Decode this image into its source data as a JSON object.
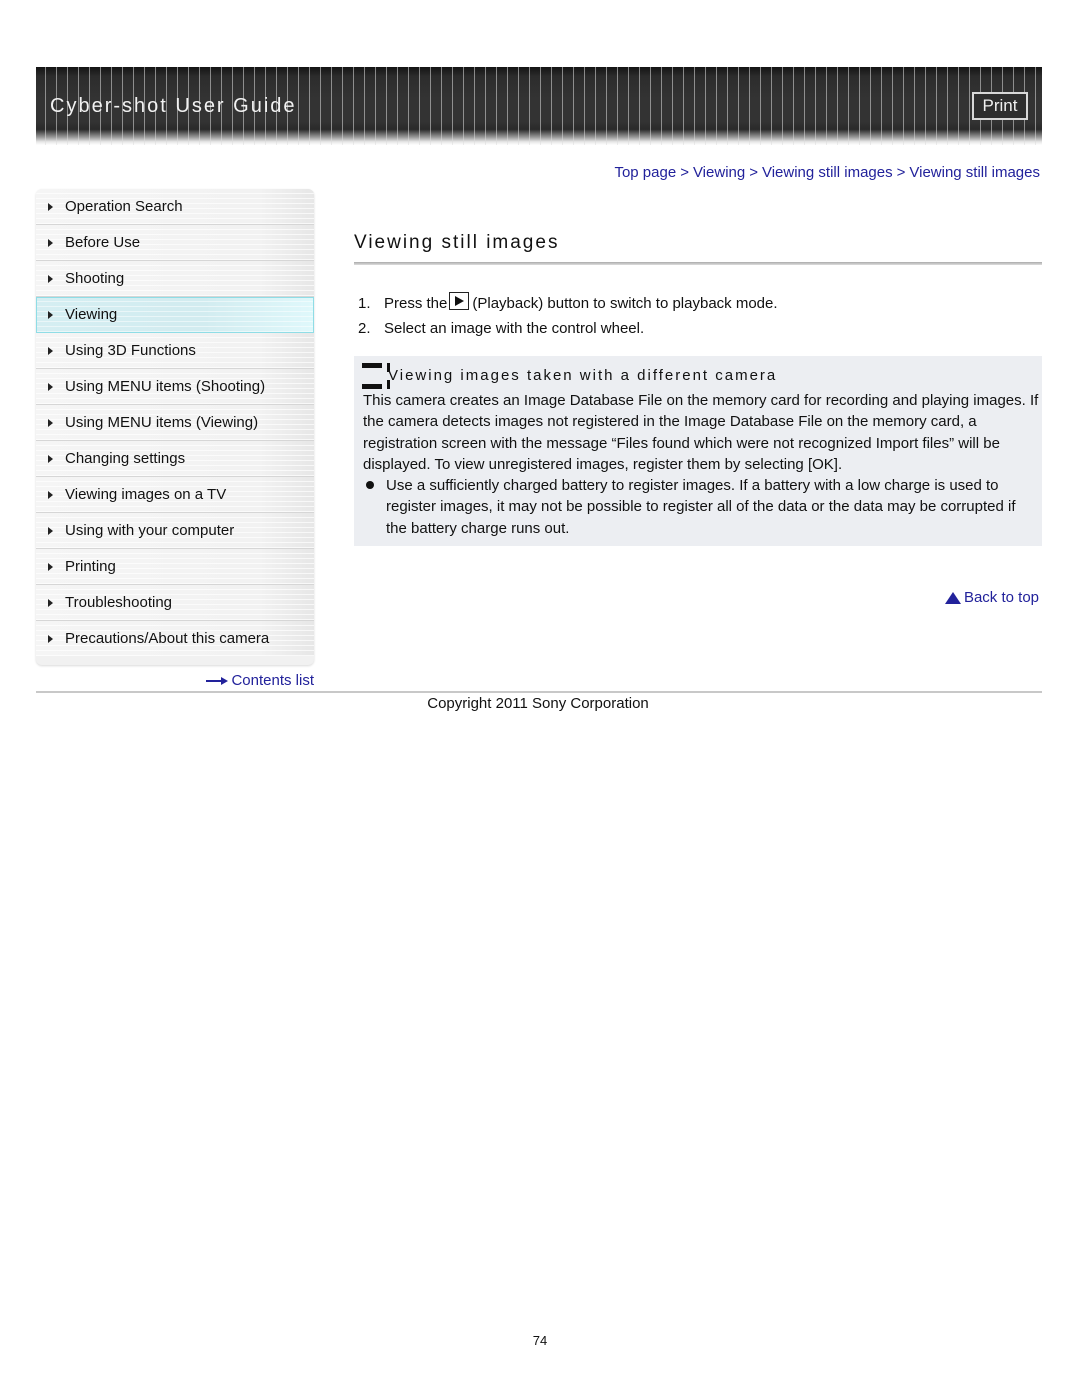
{
  "header": {
    "title": "Cyber-shot User Guide",
    "print_label": "Print"
  },
  "breadcrumb": {
    "items": [
      "Top page",
      "Viewing",
      "Viewing still images",
      "Viewing still images"
    ],
    "separator": ">"
  },
  "sidebar": {
    "items": [
      {
        "label": "Operation Search",
        "active": false
      },
      {
        "label": "Before Use",
        "active": false
      },
      {
        "label": "Shooting",
        "active": false
      },
      {
        "label": "Viewing",
        "active": true
      },
      {
        "label": "Using 3D Functions",
        "active": false
      },
      {
        "label": "Using MENU items (Shooting)",
        "active": false
      },
      {
        "label": "Using MENU items (Viewing)",
        "active": false
      },
      {
        "label": "Changing settings",
        "active": false
      },
      {
        "label": "Viewing images on a TV",
        "active": false
      },
      {
        "label": "Using with your computer",
        "active": false
      },
      {
        "label": "Printing",
        "active": false
      },
      {
        "label": "Troubleshooting",
        "active": false
      },
      {
        "label": "Precautions/About this camera",
        "active": false
      }
    ],
    "contents_link": "Contents list"
  },
  "main": {
    "title": "Viewing still images",
    "steps": [
      {
        "num": "1.",
        "before_icon": "Press the",
        "icon": "playback-icon",
        "after_icon": "(Playback) button to switch to playback mode."
      },
      {
        "num": "2.",
        "text": "Select an image with the control wheel."
      }
    ],
    "note": {
      "icon": "note-icon",
      "heading": "Viewing images taken with a different camera",
      "body": "This camera creates an Image Database File on the memory card for recording and playing images. If the camera detects images not registered in the Image Database File on the memory card, a registration screen with the message “Files found which were not recognized Import files” will be displayed. To view unregistered images, register them by selecting [OK].",
      "bullet": "Use a sufficiently charged battery to register images. If a battery with a low charge is used to register images, it may not be possible to register all of the data or the data may be corrupted if the battery charge runs out."
    },
    "back_to_top": "Back to top"
  },
  "footer": {
    "copyright": "Copyright 2011 Sony Corporation",
    "page_number": "74"
  },
  "colors": {
    "link": "#22229b",
    "active_item": "#d5eef2",
    "note_background": "#eceef2",
    "header_background": "#333333"
  }
}
